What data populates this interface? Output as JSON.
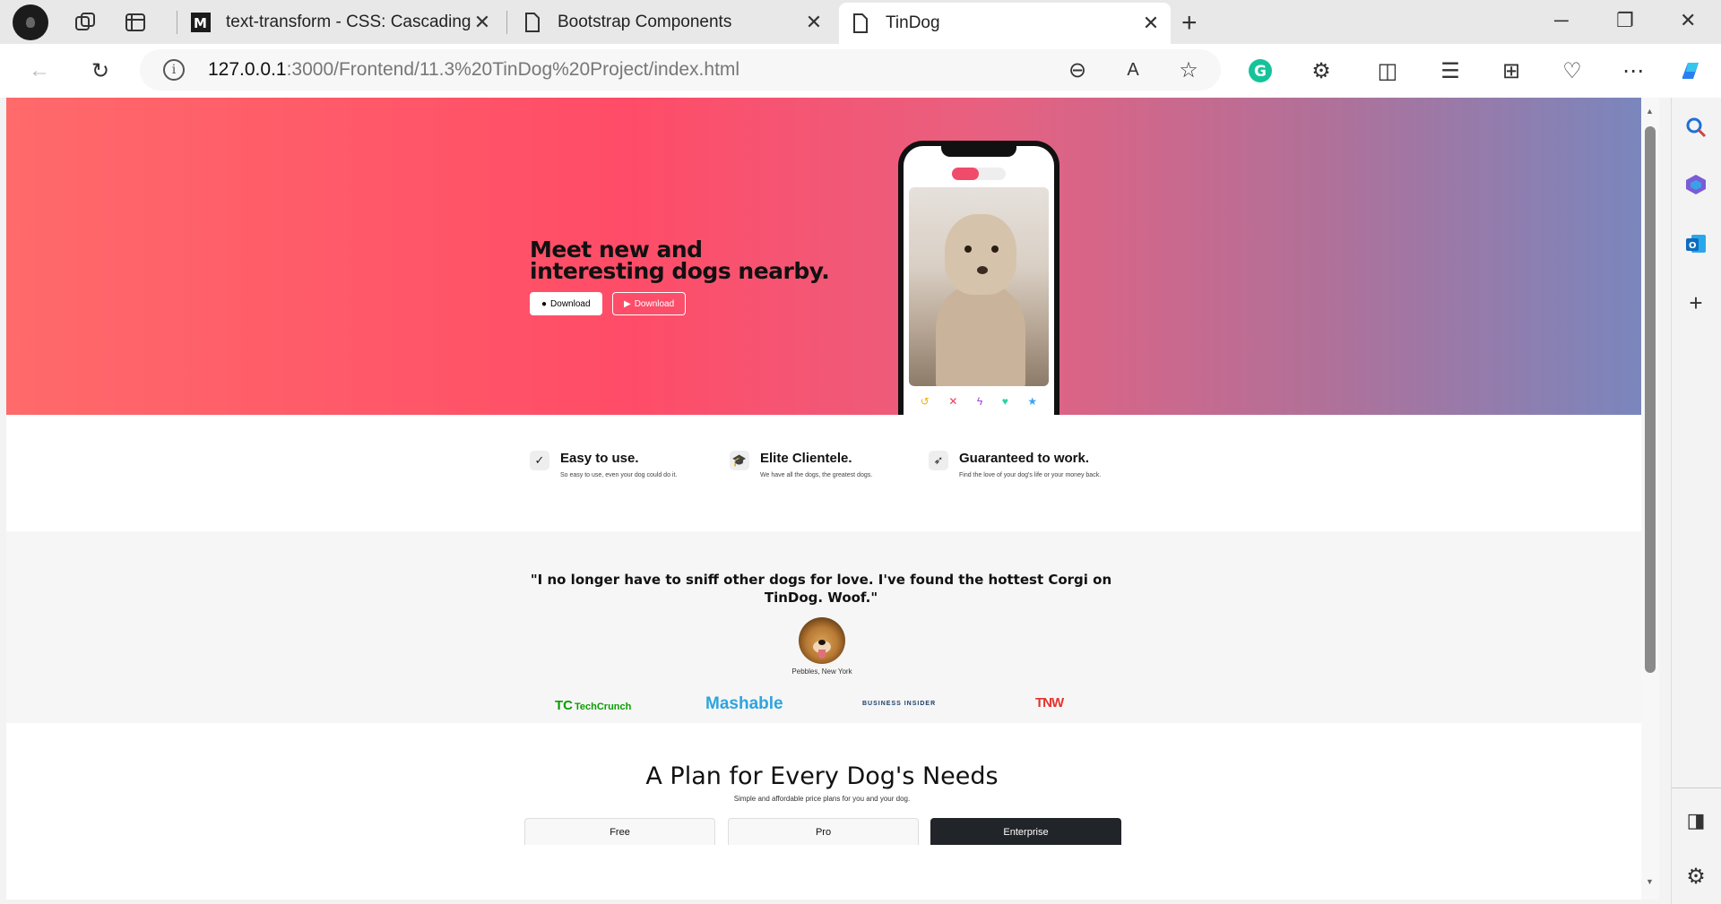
{
  "browser": {
    "tabs": [
      {
        "title": "text-transform - CSS: Cascading S",
        "favicon": "mdn-logo-icon"
      },
      {
        "title": "Bootstrap Components",
        "favicon": "page-icon"
      },
      {
        "title": "TinDog",
        "favicon": "page-icon",
        "active": true
      }
    ],
    "address": {
      "host": "127.0.0.1",
      "rest": ":3000/Frontend/11.3%20TinDog%20Project/index.html"
    }
  },
  "hero": {
    "headline": "Meet new and interesting dogs nearby.",
    "buttons": [
      {
        "label": "Download",
        "icon": "apple-icon"
      },
      {
        "label": "Download",
        "icon": "play-icon"
      }
    ]
  },
  "features": [
    {
      "title": "Easy to use.",
      "text": "So easy to use, even your dog could do it.",
      "icon": "check-circle-icon"
    },
    {
      "title": "Elite Clientele.",
      "text": "We have all the dogs, the greatest dogs.",
      "icon": "graduation-cap-icon"
    },
    {
      "title": "Guaranteed to work.",
      "text": "Find the love of your dog's life or your money back.",
      "icon": "heart-arrow-icon"
    }
  ],
  "testimonial": {
    "quote": "\"I no longer have to sniff other dogs for love. I've found the hottest Corgi on TinDog. Woof.\"",
    "caption": "Pebbles, New York"
  },
  "press": [
    {
      "name": "TechCrunch",
      "mark": "TC",
      "color": "#0a9e01"
    },
    {
      "name": "Mashable",
      "color": "#2ea4de"
    },
    {
      "name": "BUSINESS INSIDER",
      "color": "#1b3f6b"
    },
    {
      "name": "TNW",
      "color": "#e3342f"
    }
  ],
  "pricing": {
    "title": "A Plan for Every Dog's Needs",
    "subtitle": "Simple and affordable price plans for you and your dog.",
    "plans": [
      "Free",
      "Pro",
      "Enterprise"
    ]
  },
  "colors": {
    "hero_start": "#ff6a6a",
    "hero_mid": "#ff4c68",
    "hero_end": "#7a86bd",
    "accent": "#f04b6a"
  }
}
